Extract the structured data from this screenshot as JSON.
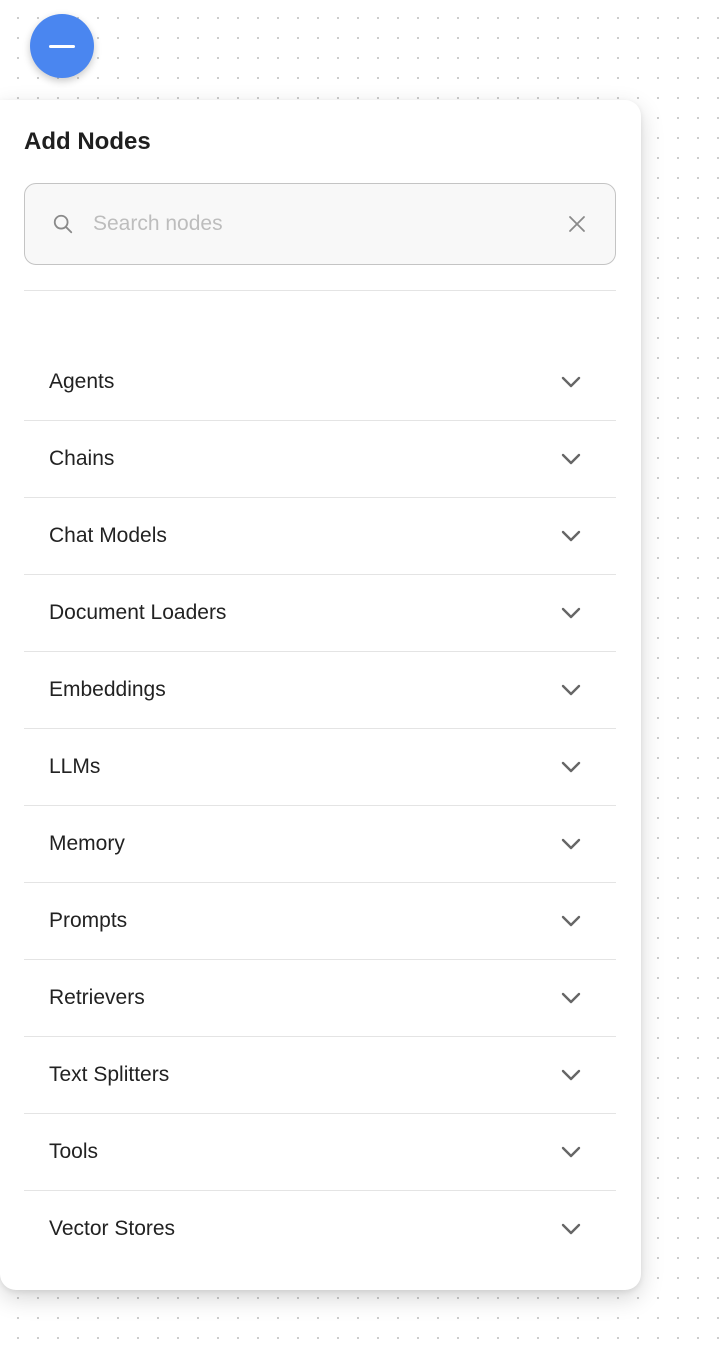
{
  "fab": {
    "icon": "minus-icon",
    "color": "#4a86f0"
  },
  "panel": {
    "title": "Add Nodes",
    "search": {
      "placeholder": "Search nodes",
      "value": "",
      "icon": "search-icon",
      "clear_icon": "close-icon"
    },
    "categories": [
      {
        "label": "Agents",
        "icon": "chevron-down-icon"
      },
      {
        "label": "Chains",
        "icon": "chevron-down-icon"
      },
      {
        "label": "Chat Models",
        "icon": "chevron-down-icon"
      },
      {
        "label": "Document Loaders",
        "icon": "chevron-down-icon"
      },
      {
        "label": "Embeddings",
        "icon": "chevron-down-icon"
      },
      {
        "label": "LLMs",
        "icon": "chevron-down-icon"
      },
      {
        "label": "Memory",
        "icon": "chevron-down-icon"
      },
      {
        "label": "Prompts",
        "icon": "chevron-down-icon"
      },
      {
        "label": "Retrievers",
        "icon": "chevron-down-icon"
      },
      {
        "label": "Text Splitters",
        "icon": "chevron-down-icon"
      },
      {
        "label": "Tools",
        "icon": "chevron-down-icon"
      },
      {
        "label": "Vector Stores",
        "icon": "chevron-down-icon"
      }
    ]
  }
}
